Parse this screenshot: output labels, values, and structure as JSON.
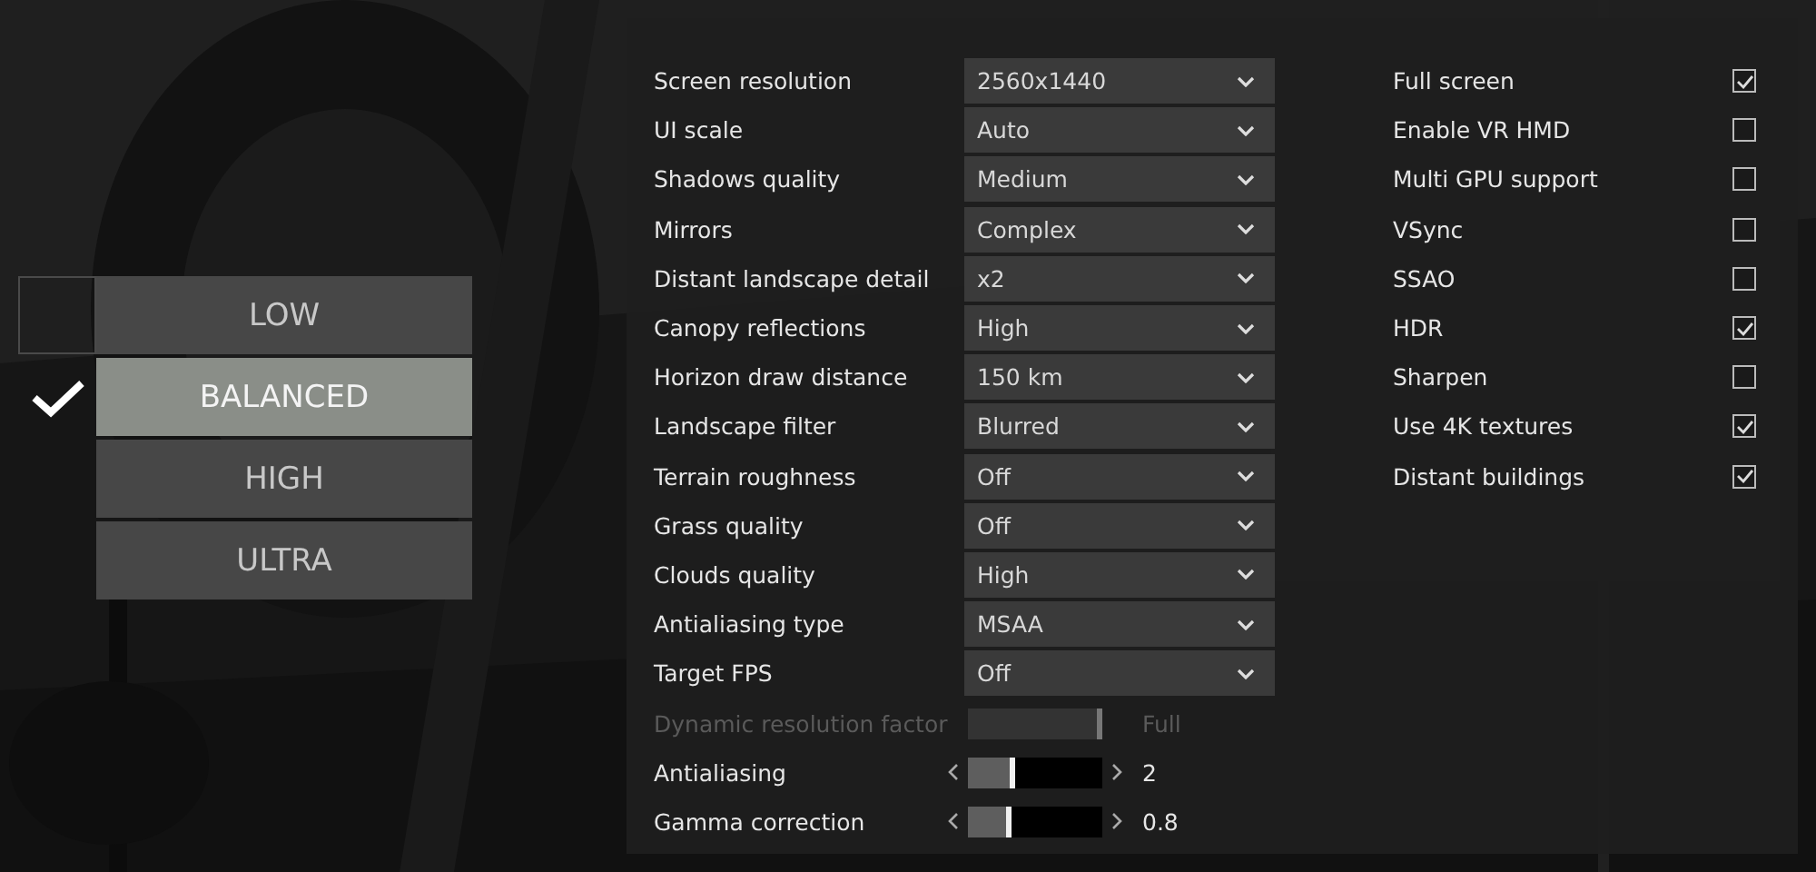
{
  "presets": [
    {
      "label": "LOW",
      "selected": false,
      "hovered": true
    },
    {
      "label": "BALANCED",
      "selected": true,
      "hovered": false
    },
    {
      "label": "HIGH",
      "selected": false,
      "hovered": false
    },
    {
      "label": "ULTRA",
      "selected": false,
      "hovered": false
    }
  ],
  "settings": [
    {
      "kind": "dropdown",
      "label": "Screen resolution",
      "value": "2560x1440"
    },
    {
      "kind": "dropdown",
      "label": "UI scale",
      "value": "Auto"
    },
    {
      "kind": "dropdown",
      "label": "Shadows quality",
      "value": "Medium"
    },
    {
      "kind": "dropdown",
      "label": "Mirrors",
      "value": "Complex"
    },
    {
      "kind": "dropdown",
      "label": "Distant landscape detail",
      "value": "x2"
    },
    {
      "kind": "dropdown",
      "label": "Canopy reflections",
      "value": "High"
    },
    {
      "kind": "dropdown",
      "label": "Horizon draw distance",
      "value": "150 km"
    },
    {
      "kind": "dropdown",
      "label": "Landscape filter",
      "value": "Blurred"
    },
    {
      "kind": "dropdown",
      "label": "Terrain roughness",
      "value": "Off"
    },
    {
      "kind": "dropdown",
      "label": "Grass quality",
      "value": "Off"
    },
    {
      "kind": "dropdown",
      "label": "Clouds quality",
      "value": "High"
    },
    {
      "kind": "dropdown",
      "label": "Antialiasing type",
      "value": "MSAA"
    },
    {
      "kind": "dropdown",
      "label": "Target FPS",
      "value": "Off"
    },
    {
      "kind": "slider",
      "label": "Dynamic resolution factor",
      "value": "Full",
      "level": 1.0,
      "disabled": true
    },
    {
      "kind": "slider",
      "label": "Antialiasing",
      "value": "2",
      "level": 0.33,
      "disabled": false
    },
    {
      "kind": "slider",
      "label": "Gamma correction",
      "value": "0.8",
      "level": 0.29,
      "disabled": false
    }
  ],
  "toggles": [
    {
      "label": "Full screen",
      "checked": true
    },
    {
      "label": "Enable VR HMD",
      "checked": false
    },
    {
      "label": "Multi GPU support",
      "checked": false
    },
    {
      "label": "VSync",
      "checked": false
    },
    {
      "label": "SSAO",
      "checked": false
    },
    {
      "label": "HDR",
      "checked": true
    },
    {
      "label": "Sharpen",
      "checked": false
    },
    {
      "label": "Use 4K textures",
      "checked": true
    },
    {
      "label": "Distant buildings",
      "checked": true
    }
  ]
}
